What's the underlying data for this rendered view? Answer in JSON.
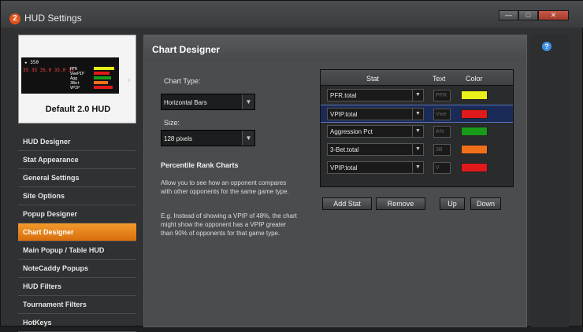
{
  "window": {
    "title": "HUD Settings",
    "app_icon": "2",
    "controls": {
      "minimize": "—",
      "maximize": "□",
      "close": "✕"
    }
  },
  "preview": {
    "hud_line1": "★ 350",
    "hud_line2": "35 35 35.0 35.0 35",
    "hud_labels": "PFR\nVwePIP\nAgg\n3Bet\nVPIP",
    "name": "Default 2.0 HUD",
    "dropdown_glyph": "▼"
  },
  "sidebar": {
    "items": [
      {
        "label": "HUD Designer",
        "active": false
      },
      {
        "label": "Stat Appearance",
        "active": false
      },
      {
        "label": "General Settings",
        "active": false
      },
      {
        "label": "Site Options",
        "active": false
      },
      {
        "label": "Popup Designer",
        "active": false
      },
      {
        "label": "Chart Designer",
        "active": true
      },
      {
        "label": "Main Popup / Table HUD",
        "active": false
      },
      {
        "label": "NoteCaddy Popups",
        "active": false
      },
      {
        "label": "HUD Filters",
        "active": false
      },
      {
        "label": "Tournament Filters",
        "active": false
      },
      {
        "label": "HotKeys",
        "active": false
      }
    ]
  },
  "panel": {
    "title": "Chart Designer",
    "chart_type_label": "Chart Type:",
    "chart_type_value": "Horizontal Bars",
    "size_label": "Size:",
    "size_value": "128 pixels",
    "percentile_heading": "Percentile Rank Charts",
    "para1": "Allow you to see how an opponent compares with other opponents for the same game type.",
    "para2": "E.g. Instead of showing a VPIP of 48%, the chart might show the opponent has a VPIP greater than 90% of opponents for that game type."
  },
  "grid": {
    "headers": {
      "stat": "Stat",
      "text": "Text",
      "color": "Color"
    },
    "rows": [
      {
        "stat": "PFR.total",
        "text": "PFR",
        "color": "#e8f01a",
        "selected": false
      },
      {
        "stat": "VPIP.total",
        "text": "Vwe",
        "color": "#e01a1a",
        "selected": true
      },
      {
        "stat": "Aggression Pct",
        "text": "A%",
        "color": "#1a9a1a",
        "selected": false
      },
      {
        "stat": "3-Bet.total",
        "text": "3B",
        "color": "#f0701a",
        "selected": false
      },
      {
        "stat": "VPIP.total",
        "text": "V",
        "color": "#e01a1a",
        "selected": false
      }
    ]
  },
  "buttons": {
    "add_stat": "Add Stat",
    "remove": "Remove",
    "up": "Up",
    "down": "Down"
  },
  "icons": {
    "dropdown": "▼",
    "help": "?"
  },
  "colors": {
    "accent": "#e8841c",
    "selection": "#1b2b57"
  }
}
